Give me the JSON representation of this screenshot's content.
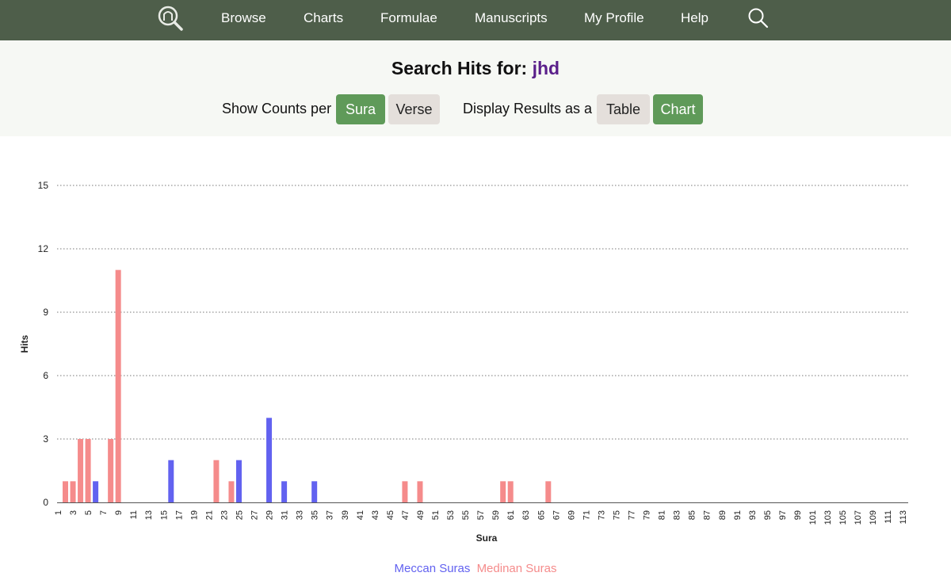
{
  "nav": {
    "items": [
      "Browse",
      "Charts",
      "Formulae",
      "Manuscripts",
      "My Profile",
      "Help"
    ],
    "logo_icon": "magnifier-logo-icon",
    "search_icon": "search-icon"
  },
  "header": {
    "title_prefix": "Search Hits for:",
    "search_term": "jhd"
  },
  "controls": {
    "counts_label": "Show Counts per",
    "sura_label": "Sura",
    "verse_label": "Verse",
    "display_label": "Display Results as a",
    "table_label": "Table",
    "chart_label": "Chart",
    "active_count_mode": "Sura",
    "active_display_mode": "Chart"
  },
  "colors": {
    "nav_bg": "#4e5e4a",
    "active_button": "#5f9a59",
    "inactive_button": "#e4dfdb",
    "meccan": "#6262f0",
    "medinan": "#f58b8b",
    "search_term": "#5a1f8a"
  },
  "chart_data": {
    "type": "bar",
    "xlabel": "Sura",
    "ylabel": "Hits",
    "ylim": [
      0,
      15
    ],
    "yticks": [
      0,
      3,
      6,
      9,
      12,
      15
    ],
    "x_range": [
      1,
      114
    ],
    "x_tick_step": 2,
    "grid": "horizontal dotted",
    "legend_position": "bottom-center",
    "series": [
      {
        "name": "Meccan Suras",
        "color": "#6262f0",
        "points": [
          [
            6,
            1
          ],
          [
            16,
            2
          ],
          [
            25,
            2
          ],
          [
            29,
            4
          ],
          [
            31,
            1
          ],
          [
            35,
            1
          ]
        ]
      },
      {
        "name": "Medinan Suras",
        "color": "#f58b8b",
        "points": [
          [
            2,
            1
          ],
          [
            3,
            1
          ],
          [
            4,
            3
          ],
          [
            5,
            3
          ],
          [
            8,
            3
          ],
          [
            9,
            11
          ],
          [
            22,
            2
          ],
          [
            24,
            1
          ],
          [
            47,
            1
          ],
          [
            49,
            1
          ],
          [
            60,
            1
          ],
          [
            61,
            1
          ],
          [
            66,
            1
          ]
        ]
      }
    ]
  }
}
